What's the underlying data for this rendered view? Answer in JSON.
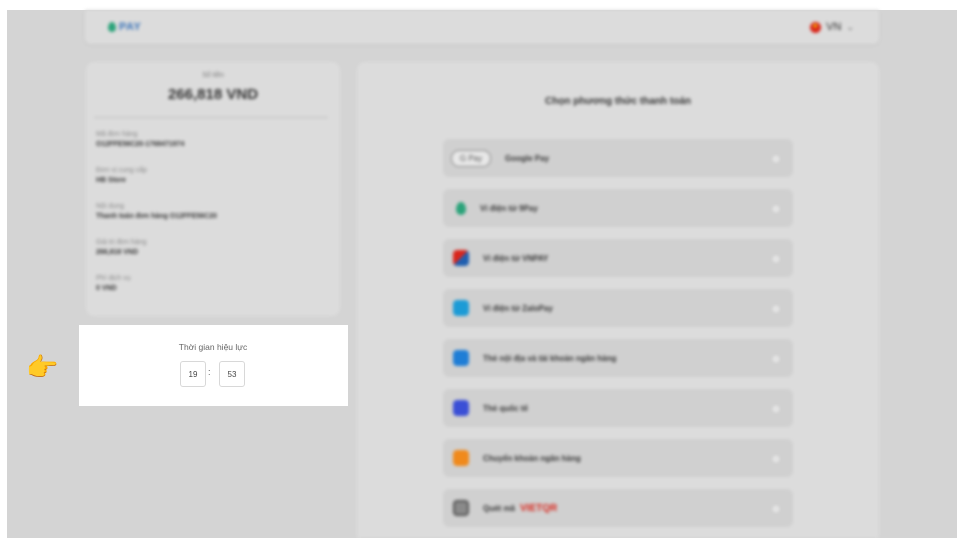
{
  "header": {
    "logo_text": "PAY",
    "language": "VN",
    "language_chevron": "⌄"
  },
  "order": {
    "amount_label": "Số tiền",
    "amount": "266,818 VND",
    "fields": [
      {
        "label": "Mã đơn hàng",
        "value": "O12FFE56C20-1768471974"
      },
      {
        "label": "Đơn vị cung cấp",
        "value": "HB Store"
      },
      {
        "label": "Nội dung",
        "value": "Thanh toán đơn hàng O12FFE56C20"
      },
      {
        "label": "Giá trị đơn hàng",
        "value": "266,818 VND"
      },
      {
        "label": "Phí dịch vụ",
        "value": "0 VND"
      }
    ]
  },
  "validity": {
    "title": "Thời gian hiệu lực",
    "minutes": "19",
    "separator": ":",
    "seconds": "53"
  },
  "payment": {
    "title": "Chọn phương thức thanh toán",
    "methods": [
      {
        "label": "Google Pay",
        "icon": "google-pay-icon",
        "icon_text": "G Pay"
      },
      {
        "label": "Ví điện tử 9Pay",
        "icon": "9pay-icon"
      },
      {
        "label": "Ví điện tử VNPAY",
        "icon": "vnpay-icon"
      },
      {
        "label": "Ví điện tử ZaloPay",
        "icon": "zalopay-icon"
      },
      {
        "label": "Thẻ nội địa và tài khoản ngân hàng",
        "icon": "domestic-card-icon"
      },
      {
        "label": "Thẻ quốc tế",
        "icon": "international-card-icon"
      },
      {
        "label": "Chuyển khoản ngân hàng",
        "icon": "bank-transfer-icon"
      },
      {
        "label": "Quét mã",
        "icon": "qr-icon",
        "brand": "VIETQR"
      }
    ]
  },
  "pointer": {
    "glyph": "👉"
  },
  "colors": {
    "background": "#d4d4d4",
    "card": "#dcdcdc",
    "highlight": "#ffffff",
    "brand": "#3b74b9"
  }
}
